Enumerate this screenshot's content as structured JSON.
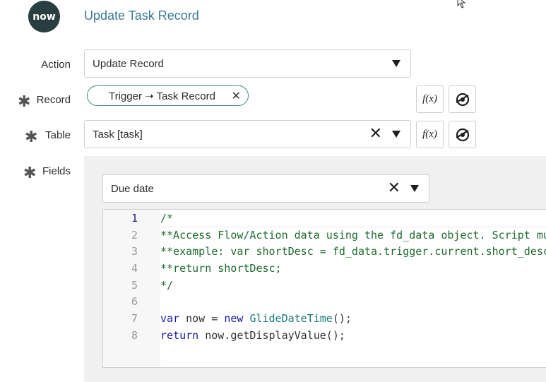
{
  "header": {
    "logo_text": "now",
    "title": "Update Task Record"
  },
  "form": {
    "action": {
      "label": "Action",
      "value": "Update Record"
    },
    "record": {
      "label": "Record",
      "pill": "Trigger ➝ Task Record",
      "clear": "✕"
    },
    "table": {
      "label": "Table",
      "value": "Task [task]",
      "clear": "✕"
    },
    "fields": {
      "label": "Fields",
      "selected": "Due date",
      "clear": "✕"
    },
    "required_mark": "✱",
    "fx_label": "f(x)"
  },
  "script": {
    "lines": [
      {
        "num": "1",
        "parts": [
          {
            "t": "/*",
            "c": "cmt"
          }
        ]
      },
      {
        "num": "2",
        "parts": [
          {
            "t": "**Access Flow/Action data using the fd_data object. Script must return a value.",
            "c": "cmt"
          }
        ]
      },
      {
        "num": "3",
        "parts": [
          {
            "t": "**example: var shortDesc = fd_data.trigger.current.short_description;",
            "c": "cmt"
          }
        ]
      },
      {
        "num": "4",
        "parts": [
          {
            "t": "**return shortDesc;",
            "c": "cmt"
          }
        ]
      },
      {
        "num": "5",
        "parts": [
          {
            "t": "*/",
            "c": "cmt"
          }
        ]
      },
      {
        "num": "6",
        "parts": []
      },
      {
        "num": "7",
        "parts": [
          {
            "t": "var",
            "c": "kw"
          },
          {
            "t": " now = ",
            "c": ""
          },
          {
            "t": "new",
            "c": "kw"
          },
          {
            "t": " ",
            "c": ""
          },
          {
            "t": "GlideDateTime",
            "c": "ty"
          },
          {
            "t": "();",
            "c": ""
          }
        ]
      },
      {
        "num": "8",
        "parts": [
          {
            "t": "return",
            "c": "kw"
          },
          {
            "t": " now.getDisplayValue();",
            "c": ""
          }
        ]
      }
    ]
  }
}
